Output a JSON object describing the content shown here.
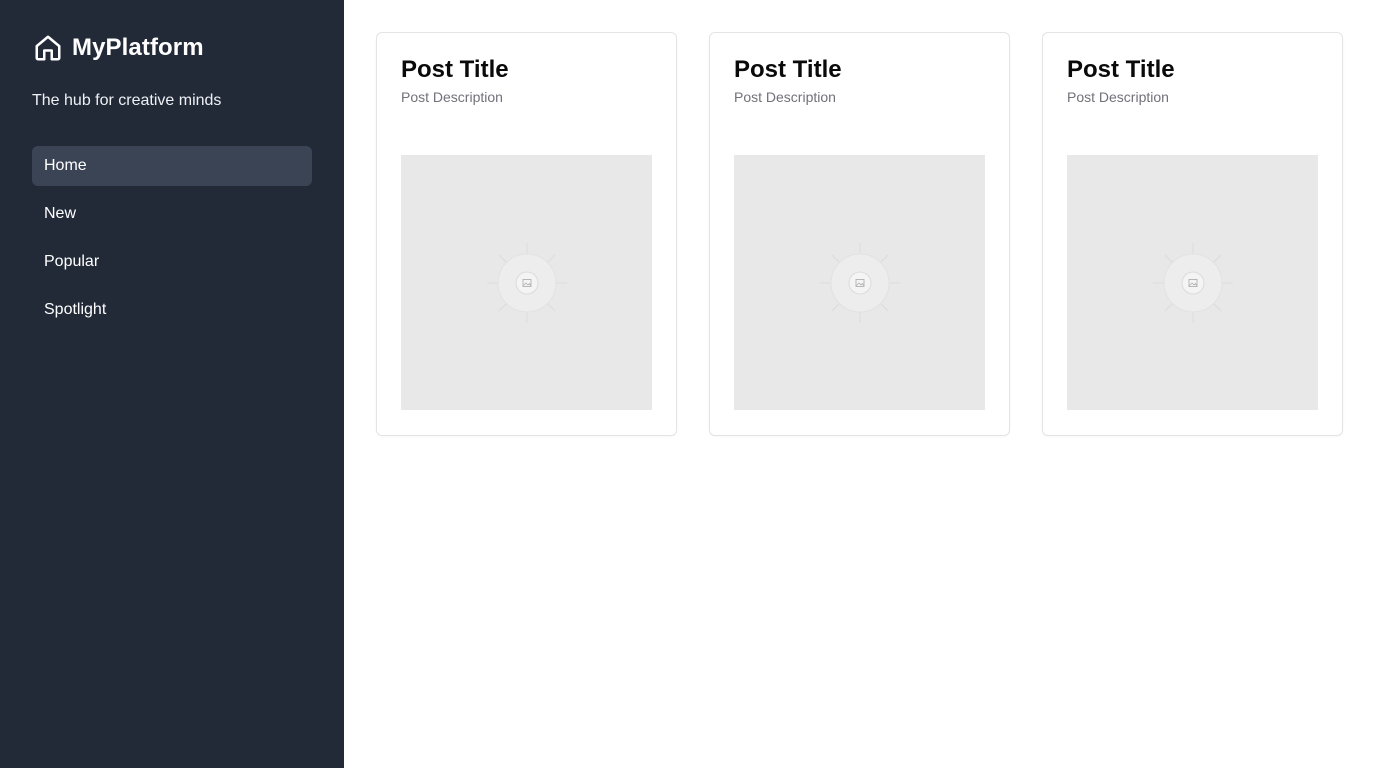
{
  "sidebar": {
    "brand": {
      "icon": "home-icon",
      "name": "MyPlatform"
    },
    "tagline": "The hub for creative minds",
    "nav": [
      {
        "label": "Home",
        "active": true
      },
      {
        "label": "New",
        "active": false
      },
      {
        "label": "Popular",
        "active": false
      },
      {
        "label": "Spotlight",
        "active": false
      }
    ]
  },
  "posts": [
    {
      "title": "Post Title",
      "description": "Post Description",
      "image": "image-placeholder-icon"
    },
    {
      "title": "Post Title",
      "description": "Post Description",
      "image": "image-placeholder-icon"
    },
    {
      "title": "Post Title",
      "description": "Post Description",
      "image": "image-placeholder-icon"
    }
  ],
  "colors": {
    "sidebar_bg": "#222a38",
    "active_nav_bg": "#3b4455",
    "card_border": "#e4e4e7",
    "image_placeholder_bg": "#e8e8e8",
    "description_text": "#71717a"
  }
}
